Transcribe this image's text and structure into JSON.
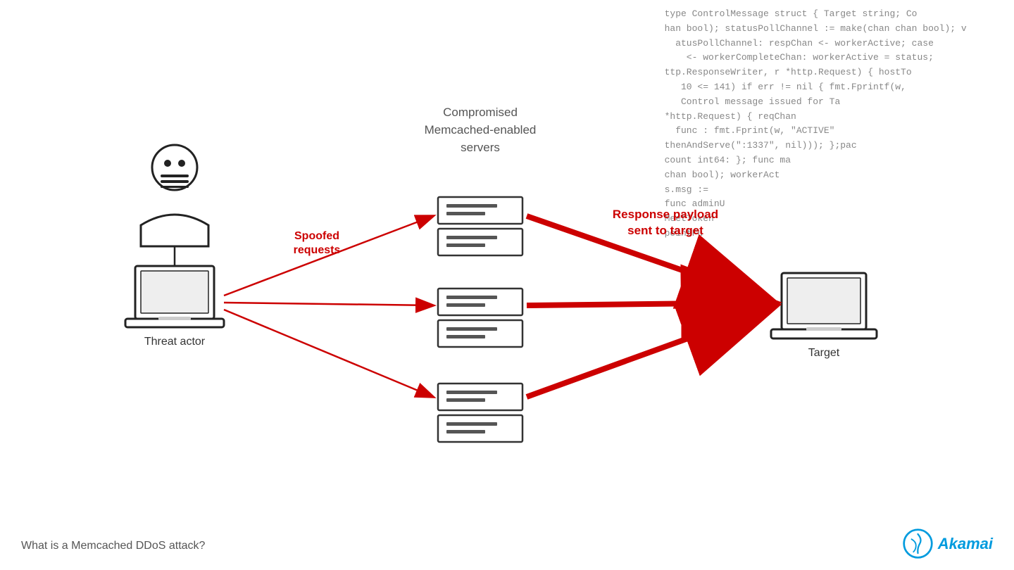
{
  "code_bg": {
    "lines": [
      "type ControlMessage struct { Target string; Co",
      "han bool); statusPollChannel := make(chan chan bool); v",
      "atusPollChannel: respChan <- workerActive; case",
      "<- workerCompleteChan: workerActive = status;",
      "ttp.ResponseWriter, r *http.Request) { hostTo",
      "10 \\u003c\\u003d 141) if err != nil { fmt.Fprintf(w,",
      "Control message issued for Ta",
      "*http.Request) { reqChan",
      "func : fmt.Fprint(w, \"ACTIVE\"",
      "thenAndServe(\":1337\", nil))); };pac",
      "count int64: }; func ma",
      "chan bool); workerAct",
      "s.msg :=",
      "func adminU",
      "MeetToken",
      "pointFu"
    ]
  },
  "diagram": {
    "compromised_label": "Compromised\nMemcached-enabled\nservers",
    "spoofed_label": "Spoofed\nrequests",
    "response_label": "Response payload\nsent to target",
    "threat_actor_label": "Threat actor",
    "target_label": "Target"
  },
  "bottom": {
    "caption": "What is a Memcached DDoS attack?",
    "brand": "Akamai"
  },
  "colors": {
    "red": "#cc0000",
    "dark": "#333333",
    "gray": "#555555",
    "akamai_blue": "#009bde"
  }
}
